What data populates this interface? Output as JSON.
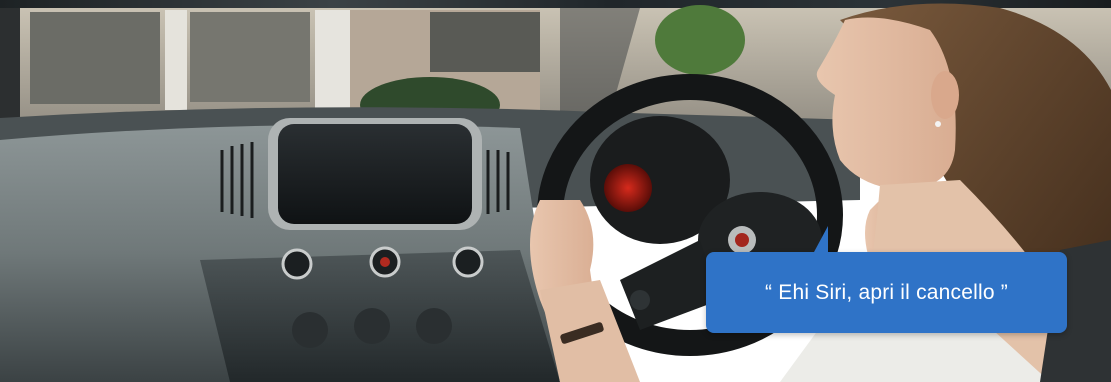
{
  "scene": {
    "description_icon": "car-interior-photo",
    "speech_bubble": {
      "text": "“ Ehi Siri, apri il cancello ”",
      "color": "#2f73c7",
      "text_color": "#ffffff"
    }
  }
}
